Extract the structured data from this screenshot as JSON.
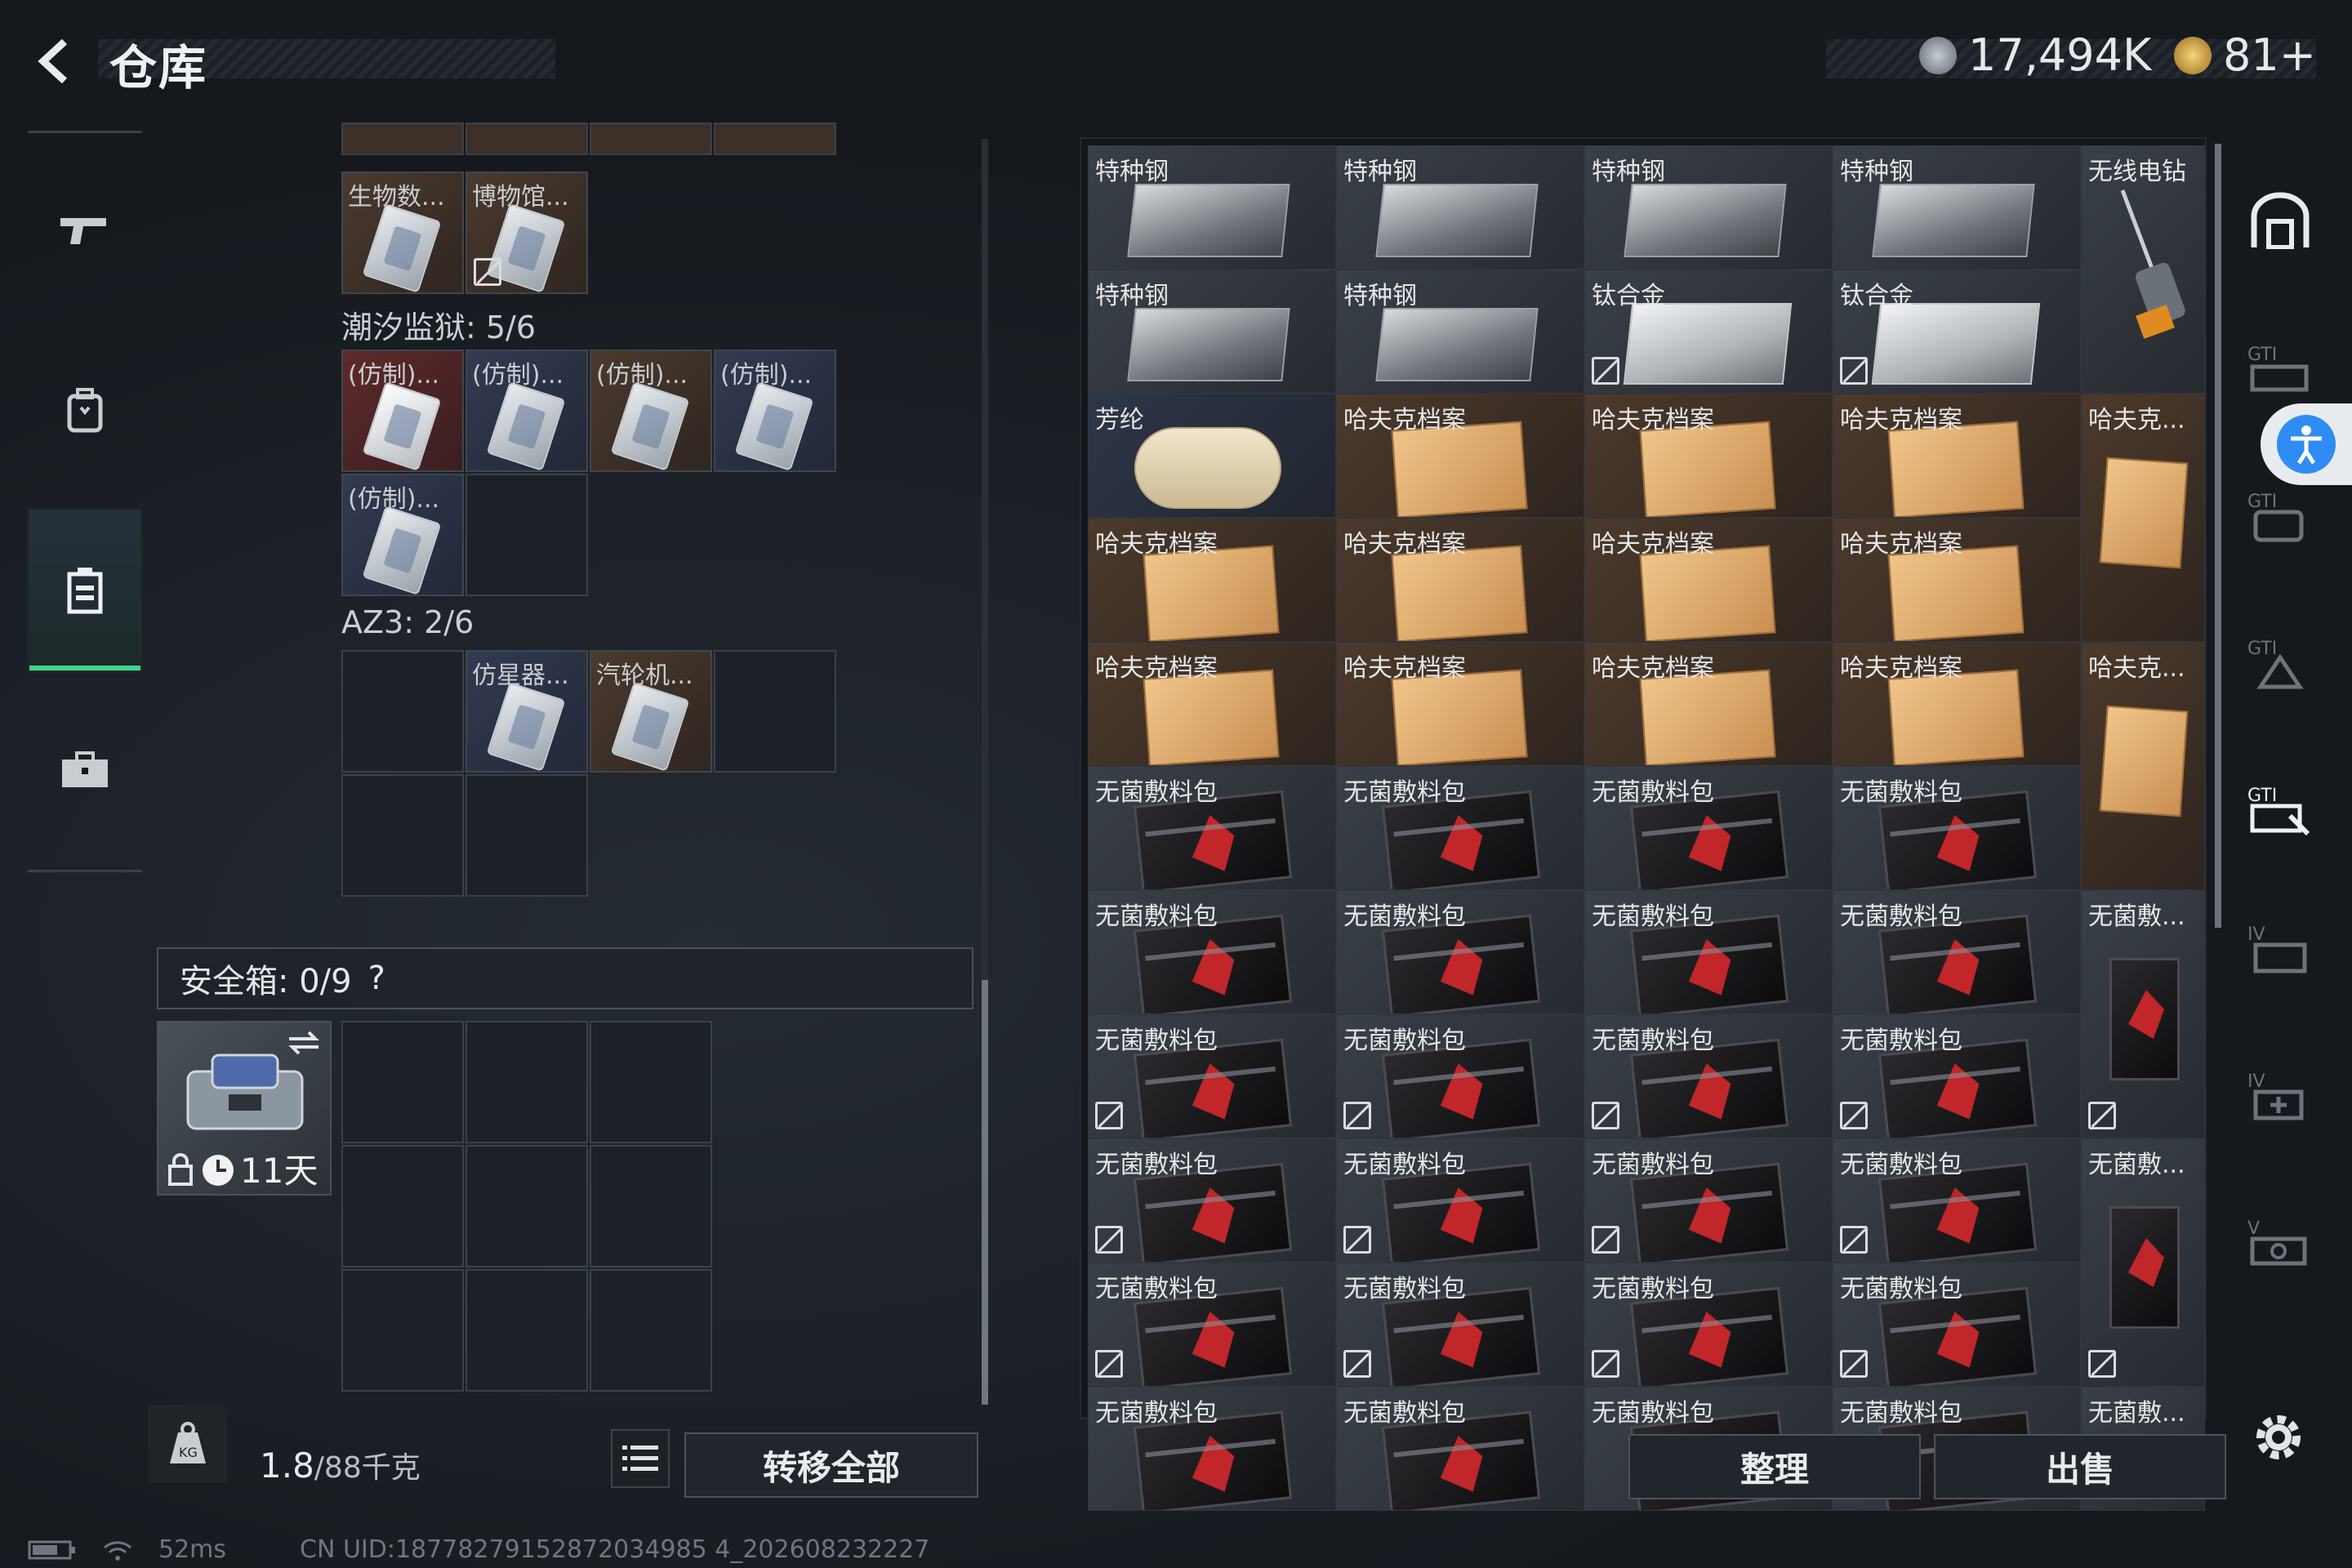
{
  "header": {
    "title": "仓库",
    "currency_hafu": "17,494K",
    "currency_coin": "81+"
  },
  "left_panel": {
    "top_items": [
      {
        "label": "生物数...",
        "style": "brown"
      },
      {
        "label": "博物馆...",
        "style": "brown"
      }
    ],
    "section_tide": "潮汐监狱: 5/6",
    "tide_items": [
      {
        "label": "(仿制)...",
        "style": "red"
      },
      {
        "label": "(仿制)...",
        "style": "blue"
      },
      {
        "label": "(仿制)...",
        "style": "brown"
      },
      {
        "label": "(仿制)...",
        "style": "blue"
      },
      {
        "label": "(仿制)...",
        "style": "blue"
      }
    ],
    "section_az3": "AZ3: 2/6",
    "az3_items": [
      {
        "label": "仿星器...",
        "style": "blue"
      },
      {
        "label": "汽轮机...",
        "style": "brown"
      }
    ],
    "safe_label": "安全箱: 0/9",
    "safe_help": "?",
    "safe_days": "11天",
    "weight_current": "1.8",
    "weight_total": "/88千克",
    "transfer_all": "转移全部"
  },
  "right_panel": {
    "rows": [
      [
        "特种钢",
        "特种钢",
        "特种钢",
        "特种钢"
      ],
      [
        "特种钢",
        "特种钢",
        "钛合金",
        "钛合金"
      ],
      [
        "芳纶",
        "哈夫克档案",
        "哈夫克档案",
        "哈夫克档案"
      ],
      [
        "哈夫克档案",
        "哈夫克档案",
        "哈夫克档案",
        "哈夫克档案"
      ],
      [
        "哈夫克档案",
        "哈夫克档案",
        "哈夫克档案",
        "哈夫克档案"
      ],
      [
        "无菌敷料包",
        "无菌敷料包",
        "无菌敷料包",
        "无菌敷料包"
      ],
      [
        "无菌敷料包",
        "无菌敷料包",
        "无菌敷料包",
        "无菌敷料包"
      ],
      [
        "无菌敷料包",
        "无菌敷料包",
        "无菌敷料包",
        "无菌敷料包"
      ],
      [
        "无菌敷料包",
        "无菌敷料包",
        "无菌敷料包",
        "无菌敷料包"
      ],
      [
        "无菌敷料包",
        "无菌敷料包",
        "无菌敷料包",
        "无菌敷料包"
      ],
      [
        "无菌敷料包",
        "无菌敷料包",
        "无菌敷料包",
        "无菌敷料包"
      ]
    ],
    "col5": [
      "无线电钻",
      "哈夫克...",
      "哈夫克...",
      "无菌敷...",
      "无菌敷...",
      "无菌敷..."
    ],
    "sort": "整理",
    "sell": "出售"
  },
  "right_nav": {
    "labels": [
      "GTI",
      "GTI",
      "GTI",
      "GTI",
      "IV",
      "IV",
      "V"
    ]
  },
  "status": {
    "ping": "52ms",
    "uid": "CN UID:18778279152872034985 4_202608232227"
  }
}
